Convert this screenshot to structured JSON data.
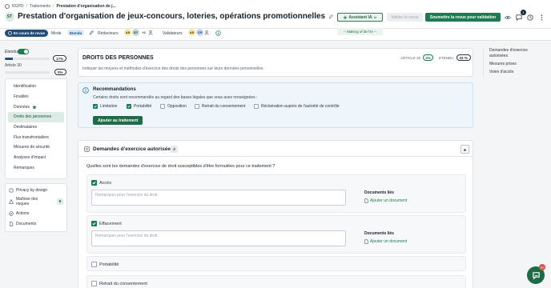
{
  "breadcrumb": {
    "root": "RGPD",
    "sep": "/",
    "level1": "Traitements",
    "current": "Prestation d'organisation de j..."
  },
  "header": {
    "initials": "ST",
    "title": "Prestation d'organisation de jeux-concours, loteries, opérations promotionnelles",
    "assistant_label": "Assistant IA",
    "validate_label": "Valider la revue",
    "submit_label": "Soumettre la revue pour validation",
    "notification_count": "1"
  },
  "subbar": {
    "status": "En cours de revue",
    "mode_label": "Mode",
    "mode_value": "Etendu",
    "redacteurs_label": "Rédacteurs",
    "redacteurs": [
      "AB",
      "DT",
      "+2"
    ],
    "validateurs_label": "Validateurs",
    "validateurs": [
      "AB",
      "CR"
    ],
    "making_of": "-- Making of de l'IA --"
  },
  "progress": {
    "etendu_label": "Etendu",
    "etendu_pct": "17%",
    "etendu_fraction": 0.17,
    "article_label": "Article 30",
    "article_pct": "0%",
    "article_fraction": 0.0
  },
  "nav": {
    "items": [
      "Identification",
      "Finalités",
      "Données",
      "Droits des personnes",
      "Destinataires",
      "Flux transfrontaliers",
      "Mesures de sécurité",
      "Analyses d'impact",
      "Remarques"
    ],
    "active_index": 3,
    "secondary": [
      {
        "label": "Privacy by design",
        "icon": "shield-icon"
      },
      {
        "label": "Maîtrise des risques",
        "badge": "5",
        "icon": "risk-icon"
      },
      {
        "label": "Actions",
        "icon": "actions-icon"
      },
      {
        "label": "Documents",
        "icon": "document-icon"
      }
    ]
  },
  "section": {
    "title": "DROITS DES PERSONNES",
    "description": "Indiquer les moyens et méthodes d'exercice des droits des personnes sur leurs données personnelles.",
    "article_label": "ARTICLE 30",
    "article_pct": "0%",
    "etendu_label": "ETENDU",
    "etendu_pct": "33 %"
  },
  "recommendations": {
    "title": "Recommandations",
    "text": "Certains droits sont recommandés au regard des bases légales que vous avez renseignées :",
    "items": [
      {
        "label": "Limitation",
        "checked": true
      },
      {
        "label": "Portabilité",
        "checked": true
      },
      {
        "label": "Opposition",
        "checked": false
      },
      {
        "label": "Retrait du consentement",
        "checked": false
      },
      {
        "label": "Réclamation auprès de l'autorité de contrôle",
        "checked": false
      }
    ],
    "button": "Ajouter au traitement"
  },
  "demandes": {
    "title": "Demandes d'exercice autorisées",
    "count": "3",
    "question": "Quelles sont les demandes d'exercice de droit susceptibles d'être formulées pour ce traitement ?",
    "placeholder": "Remarques pour l'exercice du droit",
    "docs_label": "Documents liés",
    "add_doc": "Ajouter un document",
    "rights": [
      {
        "label": "Accès",
        "checked": true
      },
      {
        "label": "Effacement",
        "checked": true
      },
      {
        "label": "Portabilité",
        "checked": false
      },
      {
        "label": "Retrait du consentement",
        "checked": false
      }
    ]
  },
  "toc": [
    "Demandes d'exercice autorisées",
    "Mesures prises",
    "Voies d'accès"
  ],
  "help_badge": "9+"
}
